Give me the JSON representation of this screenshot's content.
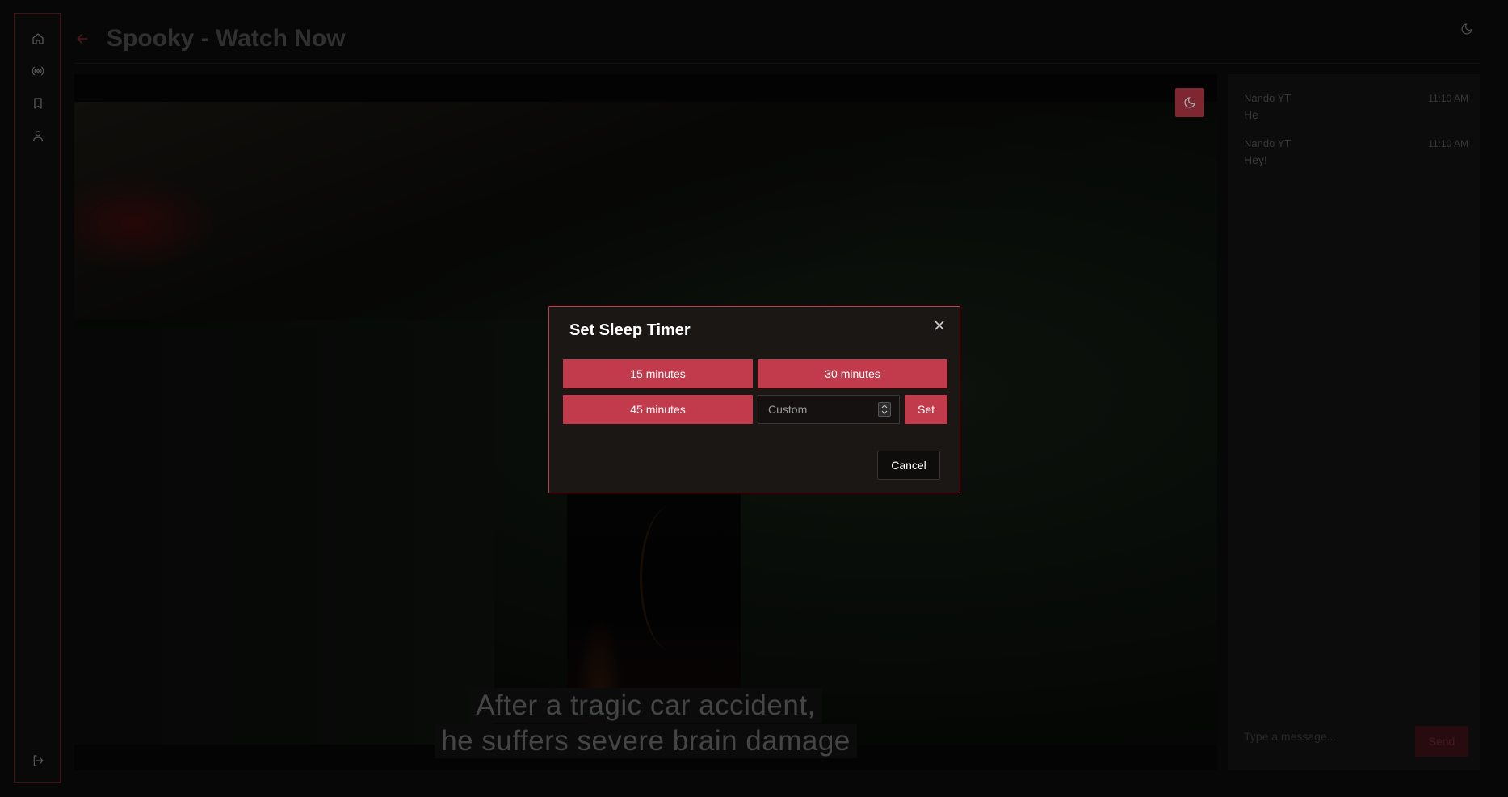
{
  "header": {
    "title": "Spooky - Watch Now"
  },
  "sidebar": {
    "items": [
      {
        "icon": "home-icon"
      },
      {
        "icon": "broadcast-icon"
      },
      {
        "icon": "bookmark-icon"
      },
      {
        "icon": "user-icon"
      }
    ],
    "bottom_icon": "logout-icon"
  },
  "video": {
    "subtitle_lines": [
      "After a tragic car accident,",
      "he suffers severe brain damage"
    ]
  },
  "chat": {
    "messages": [
      {
        "author": "Nando YT",
        "time": "11:10 AM",
        "text": "He"
      },
      {
        "author": "Nando YT",
        "time": "11:10 AM",
        "text": "Hey!"
      }
    ],
    "input_placeholder": "Type a message...",
    "send_label": "Send"
  },
  "modal": {
    "title": "Set Sleep Timer",
    "options": [
      "15 minutes",
      "30 minutes",
      "45 minutes"
    ],
    "custom_placeholder": "Custom",
    "set_label": "Set",
    "cancel_label": "Cancel"
  },
  "colors": {
    "accent": "#c23b4d",
    "modal_bg": "#1b1715",
    "background": "#0b0b0b"
  }
}
